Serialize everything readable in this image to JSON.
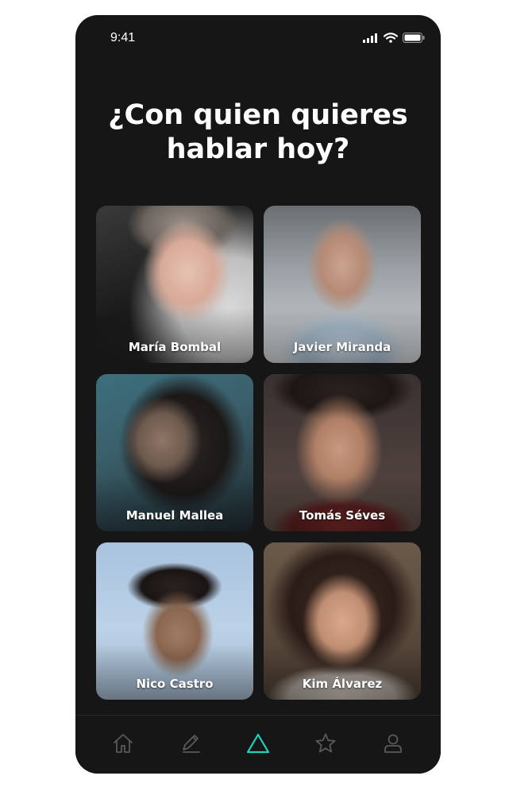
{
  "status_bar": {
    "time": "9:41"
  },
  "heading": {
    "line1": "¿Con quien quieres",
    "line2": "hablar hoy?"
  },
  "people": [
    {
      "name": "María Bombal"
    },
    {
      "name": "Javier Miranda"
    },
    {
      "name": "Manuel Mallea"
    },
    {
      "name": "Tomás Séves"
    },
    {
      "name": "Nico Castro"
    },
    {
      "name": "Kim Álvarez"
    }
  ],
  "nav": {
    "items": [
      "home-icon",
      "pencil-icon",
      "triangle-icon",
      "star-icon",
      "user-icon"
    ],
    "active": "triangle-icon"
  },
  "colors": {
    "background": "#161616",
    "accent": "#1fd1c1",
    "nav_inactive": "#5a5a5a",
    "text": "#ffffff"
  }
}
